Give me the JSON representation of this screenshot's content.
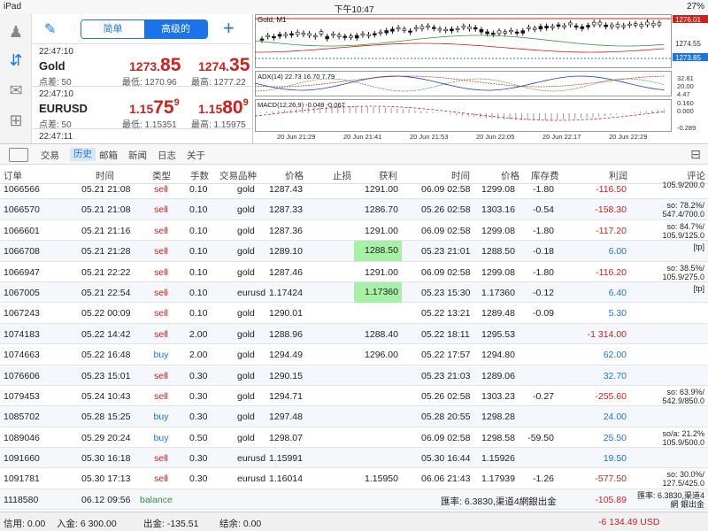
{
  "statusbar": {
    "device": "iPad",
    "time": "下午10:47",
    "battery": "27%"
  },
  "quotes": {
    "seg_simple": "简单",
    "seg_advanced": "高级的",
    "items": [
      {
        "time": "22:47:10",
        "symbol": "Gold",
        "spread": "点差: 50",
        "bid_a": "1273.",
        "bid_b": "85",
        "bid_c": "",
        "ask_a": "1274.",
        "ask_b": "35",
        "ask_c": "",
        "low": "最低: 1270.96",
        "high": "最高: 1277.22"
      },
      {
        "time": "22:47:10",
        "symbol": "EURUSD",
        "spread": "点差: 50",
        "bid_a": "1.15",
        "bid_b": "75",
        "bid_c": "9",
        "ask_a": "1.15",
        "ask_b": "80",
        "ask_c": "9",
        "low": "最低: 1.15351",
        "high": "最高: 1.15975"
      },
      {
        "time": "22:47:11",
        "symbol": "",
        "spread": "",
        "bid_a": "",
        "bid_b": "",
        "bid_c": "",
        "ask_a": "",
        "ask_b": "",
        "ask_c": "",
        "low": "",
        "high": ""
      }
    ]
  },
  "chart": {
    "title": "Gold, M1",
    "adx_label": "ADX(14) 22.73 16.70 7.79",
    "macd_label": "MACD(12,26,9) -0.048 -0.067",
    "price_top": "1276.01",
    "price_mid": "1274.55",
    "price_cur": "1273.85",
    "adx_top": "32.81",
    "adx_mid": "20.00",
    "adx_low": "4.47",
    "macd_top": "0.160",
    "macd_mid": "0.000",
    "macd_low": "-0.289",
    "times": [
      "20 Jun 21:29",
      "20 Jun 21:41",
      "20 Jun 21:53",
      "20 Jun 22:05",
      "20 Jun 22:17",
      "20 Jun 22:29"
    ],
    "colors": {
      "bull": "#ffffff",
      "bear": "#111111",
      "grid": "#dddddd",
      "current": "#1a73e8",
      "high_line": "#d0201b"
    }
  },
  "tabs": {
    "items": [
      "交易",
      "历史",
      "邮箱",
      "新闻",
      "日志",
      "关于"
    ],
    "active": "历史"
  },
  "table": {
    "headers": {
      "id": "订单",
      "time": "时间",
      "type": "类型",
      "vol": "手数",
      "sym": "交易品种",
      "price": "价格",
      "sl": "止损",
      "tp": "获利",
      "ctime": "时间",
      "cprice": "价格",
      "swap": "库存费",
      "profit": "利润",
      "comment": "评论"
    },
    "rows": [
      {
        "id": "1066566",
        "t": "05.21 21:08",
        "ty": "sell",
        "vol": "0.10",
        "sym": "gold",
        "p": "1287.43",
        "tp": "1291.00",
        "ct": "06.09 02:58",
        "cp": "1299.08",
        "sw": "-1.80",
        "pr": "-116.50",
        "cm": "105.9/200.0",
        "hl": false
      },
      {
        "id": "1066570",
        "t": "05.21 21:08",
        "ty": "sell",
        "vol": "0.10",
        "sym": "gold",
        "p": "1287.33",
        "tp": "1286.70",
        "ct": "05.26 02:58",
        "cp": "1303.16",
        "sw": "-0.54",
        "pr": "-158.30",
        "cm": "so: 78.2%/ 547.4/700.0",
        "hl": false
      },
      {
        "id": "1066601",
        "t": "05.21 21:16",
        "ty": "sell",
        "vol": "0.10",
        "sym": "gold",
        "p": "1287.36",
        "tp": "1291.00",
        "ct": "06.09 02:58",
        "cp": "1299.08",
        "sw": "-1.80",
        "pr": "-117.20",
        "cm": "so: 84.7%/ 105.9/125.0",
        "hl": false
      },
      {
        "id": "1066708",
        "t": "05.21 21:28",
        "ty": "sell",
        "vol": "0.10",
        "sym": "gold",
        "p": "1289.10",
        "tp": "1288.50",
        "ct": "05.23 21:01",
        "cp": "1288.50",
        "sw": "-0.18",
        "pr": "6.00",
        "cm": "[tp]",
        "hl": true
      },
      {
        "id": "1066947",
        "t": "05.21 22:22",
        "ty": "sell",
        "vol": "0.10",
        "sym": "gold",
        "p": "1287.46",
        "tp": "1291.00",
        "ct": "06.09 02:58",
        "cp": "1299.08",
        "sw": "-1.80",
        "pr": "-116.20",
        "cm": "so: 38.5%/ 105.9/275.0",
        "hl": false
      },
      {
        "id": "1067005",
        "t": "05.21 22:54",
        "ty": "sell",
        "vol": "0.10",
        "sym": "eurusd",
        "p": "1.17424",
        "tp": "1.17360",
        "ct": "05.23 15:30",
        "cp": "1.17360",
        "sw": "-0.12",
        "pr": "6.40",
        "cm": "[tp]",
        "hl": true
      },
      {
        "id": "1067243",
        "t": "05.22 00:09",
        "ty": "sell",
        "vol": "0.10",
        "sym": "gold",
        "p": "1290.01",
        "tp": "",
        "ct": "05.22 13:21",
        "cp": "1289.48",
        "sw": "-0.09",
        "pr": "5.30",
        "cm": "",
        "hl": false
      },
      {
        "id": "1074183",
        "t": "05.22 14:42",
        "ty": "sell",
        "vol": "2.00",
        "sym": "gold",
        "p": "1288.96",
        "tp": "1288.40",
        "ct": "05.22 18:11",
        "cp": "1295.53",
        "sw": "",
        "pr": "-1 314.00",
        "cm": "",
        "hl": false
      },
      {
        "id": "1074663",
        "t": "05.22 16:48",
        "ty": "buy",
        "vol": "2.00",
        "sym": "gold",
        "p": "1294.49",
        "tp": "1296.00",
        "ct": "05.22 17:57",
        "cp": "1294.80",
        "sw": "",
        "pr": "62.00",
        "cm": "",
        "hl": false
      },
      {
        "id": "1076606",
        "t": "05.23 15:01",
        "ty": "sell",
        "vol": "0.30",
        "sym": "gold",
        "p": "1290.15",
        "tp": "",
        "ct": "05.23 21:03",
        "cp": "1289.06",
        "sw": "",
        "pr": "32.70",
        "cm": "",
        "hl": false
      },
      {
        "id": "1079453",
        "t": "05.24 10:43",
        "ty": "sell",
        "vol": "0.30",
        "sym": "gold",
        "p": "1294.71",
        "tp": "",
        "ct": "05.26 02:58",
        "cp": "1303.23",
        "sw": "-0.27",
        "pr": "-255.60",
        "cm": "so: 63.9%/ 542.9/850.0",
        "hl": false
      },
      {
        "id": "1085702",
        "t": "05.28 15:25",
        "ty": "buy",
        "vol": "0.30",
        "sym": "gold",
        "p": "1297.48",
        "tp": "",
        "ct": "05.28 20:55",
        "cp": "1298.28",
        "sw": "",
        "pr": "24.00",
        "cm": "",
        "hl": false
      },
      {
        "id": "1089046",
        "t": "05.29 20:24",
        "ty": "buy",
        "vol": "0.50",
        "sym": "gold",
        "p": "1298.07",
        "tp": "",
        "ct": "06.09 02:58",
        "cp": "1298.58",
        "sw": "-59.50",
        "pr": "25.50",
        "cm": "so/a: 21.2% 105.9/500.0",
        "hl": false
      },
      {
        "id": "1091660",
        "t": "05.30 16:18",
        "ty": "sell",
        "vol": "0.30",
        "sym": "eurusd",
        "p": "1.15991",
        "tp": "",
        "ct": "05.30 16:44",
        "cp": "1.15926",
        "sw": "",
        "pr": "19.50",
        "cm": "",
        "hl": false
      },
      {
        "id": "1091781",
        "t": "05.30 17:13",
        "ty": "sell",
        "vol": "0.30",
        "sym": "eurusd",
        "p": "1.16014",
        "tp": "1.15950",
        "ct": "06.06 21:43",
        "cp": "1.17939",
        "sw": "-1.26",
        "pr": "-577.50",
        "cm": "so: 30.0%/ 127.5/425.0",
        "hl": false
      }
    ],
    "balance": {
      "id": "1118580",
      "t": "06.12 09:56",
      "ty": "balance",
      "rate": "匯率: 6.3830,渠道4網銀出金",
      "pr": "-105.89",
      "cm": "匯率: 6.3830,渠道4網 銀出金"
    }
  },
  "footer": {
    "credit": "信用:  0.00",
    "deposit": "入金:  6 300.00",
    "withdraw": "出金:  -135.51",
    "balance": "结余:  0.00",
    "total": "-6 134.49  USD"
  }
}
